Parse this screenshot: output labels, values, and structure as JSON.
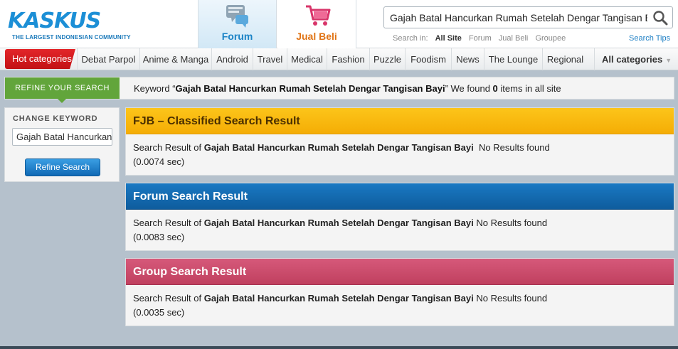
{
  "brand": {
    "logo_text": "KASKUS",
    "tagline": "THE LARGEST INDONESIAN COMMUNITY",
    "colors": {
      "primary": "#1c8fd6",
      "hot": "#d21a1e",
      "refine_green": "#62a53b"
    }
  },
  "top_tabs": [
    {
      "label": "Forum",
      "icon": "forum-icon",
      "active": true
    },
    {
      "label": "Jual Beli",
      "icon": "shopping-cart-icon",
      "active": false
    }
  ],
  "search": {
    "query": "Gajah Batal Hancurkan Rumah Setelah Dengar Tangisan Bayi",
    "scope_label": "Search in:",
    "scopes": [
      "All Site",
      "Forum",
      "Jual Beli",
      "Groupee"
    ],
    "selected_scope": "All Site",
    "tips_label": "Search Tips",
    "icon": "magnifier-icon"
  },
  "nav": {
    "hot_label": "Hot categories",
    "items": [
      "Debat Parpol",
      "Anime & Manga",
      "Android",
      "Travel",
      "Medical",
      "Fashion",
      "Puzzle",
      "Foodism",
      "News",
      "The Lounge",
      "Regional"
    ],
    "all_label": "All categories"
  },
  "keyword_bar": {
    "refine_tab": "REFINE YOUR SEARCH",
    "prefix": "Keyword “",
    "keyword": "Gajah Batal Hancurkan Rumah Setelah Dengar Tangisan Bayi",
    "middle": "” We found ",
    "count": "0",
    "suffix": " items in all site"
  },
  "sidebar": {
    "change_label": "CHANGE KEYWORD",
    "input_value": "Gajah Batal Hancurkan",
    "button_label": "Refine Search"
  },
  "results": [
    {
      "title": "FJB – Classified Search Result",
      "prefix": "Search Result of ",
      "query": "Gajah Batal Hancurkan Rumah Setelah Dengar Tangisan Bayi",
      "status": "  No Results found",
      "time": "(0.0074 sec)",
      "color": "#f7b30c"
    },
    {
      "title": "Forum Search Result",
      "prefix": "Search Result of ",
      "query": "Gajah Batal Hancurkan Rumah Setelah Dengar Tangisan Bayi",
      "status": " No Results found",
      "time": "(0.0083 sec)",
      "color": "#15699f"
    },
    {
      "title": "Group Search Result",
      "prefix": "Search Result of ",
      "query": "Gajah Batal Hancurkan Rumah Setelah Dengar Tangisan Bayi",
      "status": " No Results found",
      "time": "(0.0035 sec)",
      "color": "#c94b6a"
    }
  ]
}
